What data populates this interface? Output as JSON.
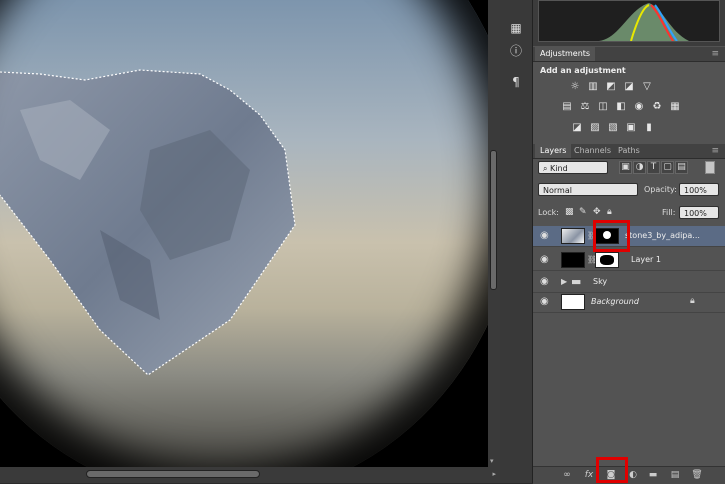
{
  "adjustments": {
    "tab_label": "Adjustments",
    "heading": "Add an adjustment"
  },
  "layers_panel": {
    "tabs": [
      {
        "label": "Layers"
      },
      {
        "label": "Channels"
      },
      {
        "label": "Paths"
      }
    ],
    "filter_kind": "Kind",
    "blend_mode": "Normal",
    "opacity_label": "Opacity:",
    "opacity_value": "100%",
    "lock_label": "Lock:",
    "fill_label": "Fill:",
    "fill_value": "100%",
    "layers": [
      {
        "name": "stone3_by_adipa..."
      },
      {
        "name": "Layer 1"
      },
      {
        "name": "Sky"
      },
      {
        "name": "Background"
      }
    ]
  },
  "icons": {
    "tools": [
      "histogram-icon",
      "info-icon",
      "character-icon"
    ],
    "adjust_row1": [
      "brightness-icon",
      "levels-icon",
      "curves-icon",
      "exposure-icon",
      "triangle-icon"
    ],
    "adjust_row2": [
      "vibrance-icon",
      "balance-icon",
      "color-balance-icon",
      "bw-icon",
      "photo-filter-icon",
      "channel-mixer-icon",
      "lookup-icon"
    ],
    "adjust_row3": [
      "invert-icon",
      "posterize-icon",
      "threshold-icon",
      "selective-color-icon",
      "gradient-map-icon"
    ],
    "bottom": [
      "link-icon",
      "fx-icon",
      "mask-icon",
      "adjust-icon",
      "folder-icon",
      "new-layer-icon",
      "trash-icon"
    ]
  },
  "accent": {
    "selection": "#5b6b85",
    "highlight": "#e00000"
  }
}
